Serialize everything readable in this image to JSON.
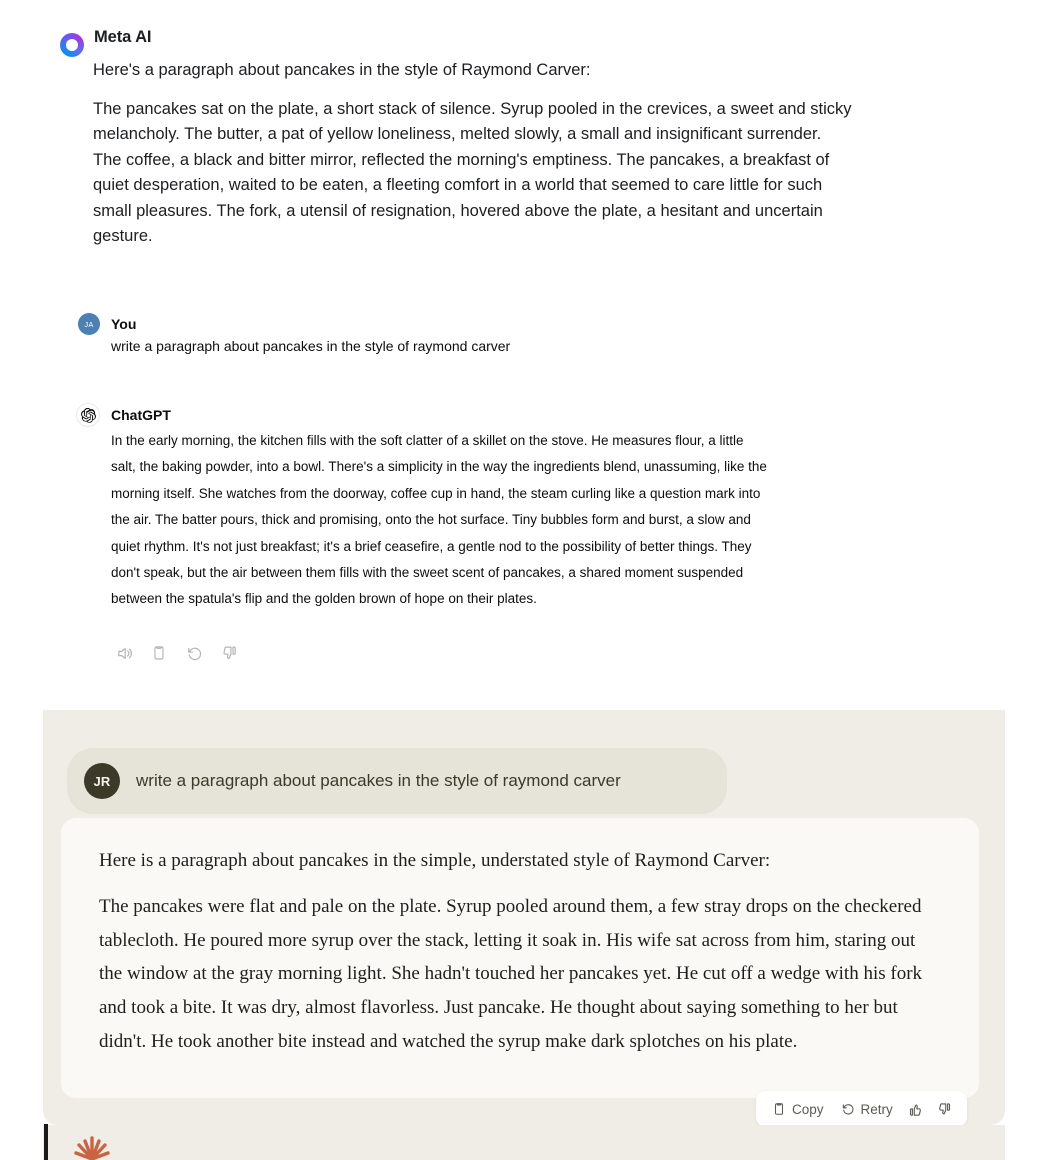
{
  "meta": {
    "assistant_name": "Meta AI",
    "logo_icon": "meta-ai-ring-icon",
    "intro": "Here's a paragraph about pancakes in the style of Raymond Carver:",
    "paragraph": "The pancakes sat on the plate, a short stack of silence. Syrup pooled in the crevices, a sweet and sticky melancholy. The butter, a pat of yellow loneliness, melted slowly, a small and insignificant surrender. The coffee, a black and bitter mirror, reflected the morning's emptiness. The pancakes, a breakfast of quiet desperation, waited to be eaten, a fleeting comfort in a world that seemed to care little for such small pleasures. The fork, a utensil of resignation, hovered above the plate, a hesitant and uncertain gesture."
  },
  "chatgpt": {
    "user_name": "You",
    "user_avatar_initials": "JA",
    "user_message": "write a paragraph about pancakes in the style of raymond carver",
    "assistant_name": "ChatGPT",
    "logo_icon": "openai-swirl-icon",
    "response": "In the early morning, the kitchen fills with the soft clatter of a skillet on the stove. He measures flour, a little salt, the baking powder, into a bowl. There's a simplicity in the way the ingredients blend, unassuming, like the morning itself. She watches from the doorway, coffee cup in hand, the steam curling like a question mark into the air. The batter pours, thick and promising, onto the hot surface. Tiny bubbles form and burst, a slow and quiet rhythm. It's not just breakfast; it's a brief ceasefire, a gentle nod to the possibility of better things. They don't speak, but the air between them fills with the sweet scent of pancakes, a shared moment suspended between the spatula's flip and the golden brown of hope on their plates.",
    "actions": [
      {
        "icon": "read-aloud-speaker-icon",
        "label": ""
      },
      {
        "icon": "copy-clipboard-icon",
        "label": ""
      },
      {
        "icon": "regenerate-refresh-icon",
        "label": ""
      },
      {
        "icon": "thumbs-down-icon",
        "label": ""
      }
    ]
  },
  "claude": {
    "user_avatar_initials": "JR",
    "user_message": "write a paragraph about pancakes in the style of raymond carver",
    "intro": "Here is a paragraph about pancakes in the simple, understated style of Raymond Carver:",
    "paragraph": "The pancakes were flat and pale on the plate. Syrup pooled around them, a few stray drops on the checkered tablecloth. He poured more syrup over the stack, letting it soak in. His wife sat across from him, staring out the window at the gray morning light. She hadn't touched her pancakes yet. He cut off a wedge with his fork and took a bite. It was dry, almost flavorless. Just pancake. He thought about saying something to her but didn't. He took another bite instead and watched the syrup make dark splotches on his plate.",
    "actions": {
      "copy_label": "Copy",
      "copy_icon": "copy-clipboard-icon",
      "retry_label": "Retry",
      "retry_icon": "retry-refresh-icon",
      "thumbs_up_icon": "thumbs-up-icon",
      "thumbs_down_icon": "thumbs-down-icon"
    },
    "next_message_logo_icon": "claude-starburst-icon"
  },
  "colors": {
    "meta_gradient_start": "#0f8cf0",
    "meta_gradient_end": "#a03ae0",
    "chatgpt_avatar_blue": "#4a80b4",
    "claude_panel_bg": "#EFEDE5",
    "claude_bubble_bg": "#E6E3D9",
    "claude_card_bg": "#FAF9F5",
    "claude_avatar_bg": "#3D3929",
    "claude_burst_orange": "#C96442"
  }
}
